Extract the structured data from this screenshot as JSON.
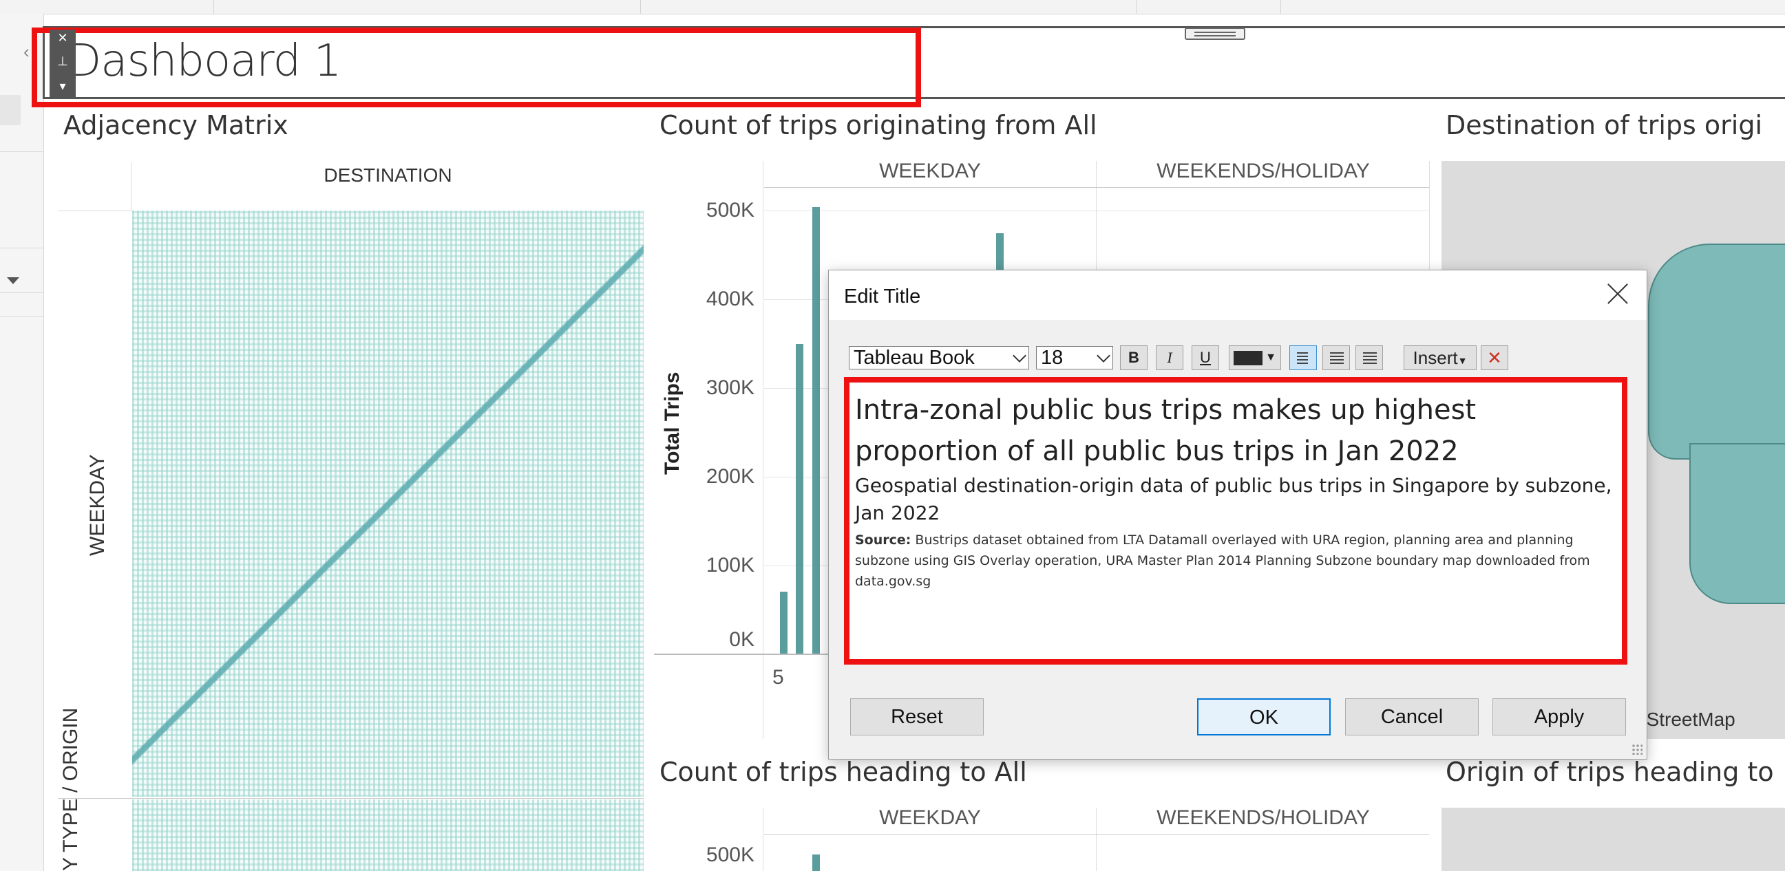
{
  "dashboard": {
    "title": "Dashboard 1"
  },
  "title_toolbar": {
    "close_icon": "✕",
    "pin_icon": "⊥",
    "menu_icon": "▾"
  },
  "sheets": {
    "adjacency": {
      "title": "Adjacency Matrix",
      "column_header": "DESTINATION",
      "row_label_1": "WEEKDAY",
      "row_label_2": "Y TYPE / ORIGIN"
    },
    "origin_chart": {
      "title": "Count of trips originating from All",
      "columns": [
        "WEEKDAY",
        "WEEKENDS/HOLIDAY"
      ],
      "ylabel": "Total Trips",
      "yticks": [
        "500K",
        "400K",
        "300K",
        "200K",
        "100K",
        "0K"
      ],
      "xtick": "5"
    },
    "dest_map": {
      "title": "Destination of trips origi",
      "attribution": "nStreetMap"
    },
    "heading_chart": {
      "title": "Count of trips heading to All",
      "columns": [
        "WEEKDAY",
        "WEEKENDS/HOLIDAY"
      ],
      "ytick_top": "500K"
    },
    "origin_map": {
      "title": "Origin of trips heading to"
    }
  },
  "chart_data": {
    "type": "bar",
    "title": "Count of trips originating from All",
    "ylabel": "Total Trips",
    "ylim": [
      0,
      500000
    ],
    "panels": [
      "WEEKDAY",
      "WEEKENDS/HOLIDAY"
    ],
    "visible_bar_values_weekday": [
      70000,
      350000,
      505000,
      475000
    ]
  },
  "dialog": {
    "title": "Edit Title",
    "toolbar": {
      "font": "Tableau Book",
      "size": "18",
      "bold": "B",
      "italic": "I",
      "underline": "U",
      "insert": "Insert"
    },
    "editor": {
      "headline": "Intra-zonal public bus trips makes up highest proportion of all public bus trips in Jan 2022",
      "subtitle": "Geospatial destination-origin data of public bus trips in Singapore by subzone, Jan 2022",
      "source_label": "Source:",
      "source_text": " Bustrips dataset obtained from LTA Datamall overlayed with URA region, planning area and planning subzone using GIS Overlay operation, URA Master Plan 2014 Planning Subzone boundary map downloaded from data.gov.sg"
    },
    "buttons": {
      "reset": "Reset",
      "ok": "OK",
      "cancel": "Cancel",
      "apply": "Apply"
    }
  }
}
